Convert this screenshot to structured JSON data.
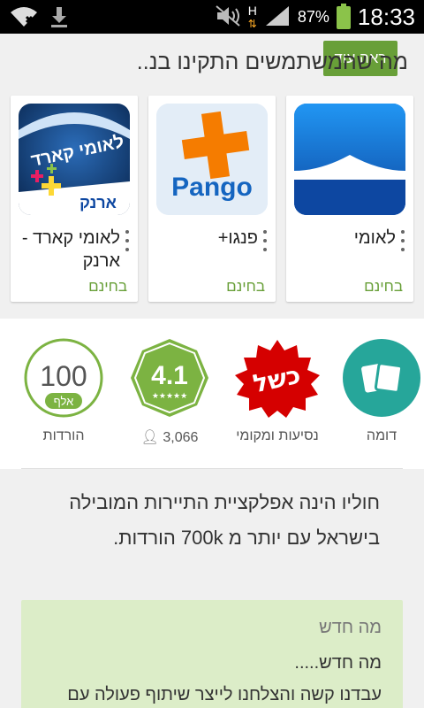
{
  "status_bar": {
    "battery_percent": "87%",
    "time": "18:33",
    "network_label": "H"
  },
  "similar": {
    "title": "מה שהמשתמשים התקינו בנ..",
    "see_more_label": "ראה עוד",
    "apps": [
      {
        "name": "לאומי",
        "price": "בחינם",
        "icon": "leumi-icon"
      },
      {
        "name": "פנגו+",
        "price": "בחינם",
        "icon": "pango-icon",
        "icon_text": "Pango"
      },
      {
        "name": "לאומי קארד - ארנק",
        "price": "בחינם",
        "icon": "leumi-card-icon",
        "icon_text_top": "לאומי קארד",
        "icon_text_bottom": "ארנק"
      }
    ]
  },
  "badges": {
    "similar_label": "דומה",
    "travel_label": "נסיעות ומקומי",
    "travel_badge_text": "כשל",
    "rating_value": "4.1",
    "rating_stars": "★★★★★",
    "rating_count": "3,066",
    "downloads_value": "100",
    "downloads_unit": "אלף",
    "downloads_label": "הורדות"
  },
  "description": {
    "text": "חוליו הינה אפלקציית התיירות המובילה בישראל עם יותר מ 700k הורדות."
  },
  "whats_new": {
    "title": "מה חדש",
    "line1": "מה חדש.....",
    "line2": "עבדנו קשה והצלחנו לייצר שיתוף פעולה עם"
  },
  "colors": {
    "accent_green": "#689f38",
    "whats_new_bg": "#dcedc8",
    "rating_green": "#7cb342",
    "similar_teal": "#26a69a",
    "travel_red": "#d50000"
  }
}
